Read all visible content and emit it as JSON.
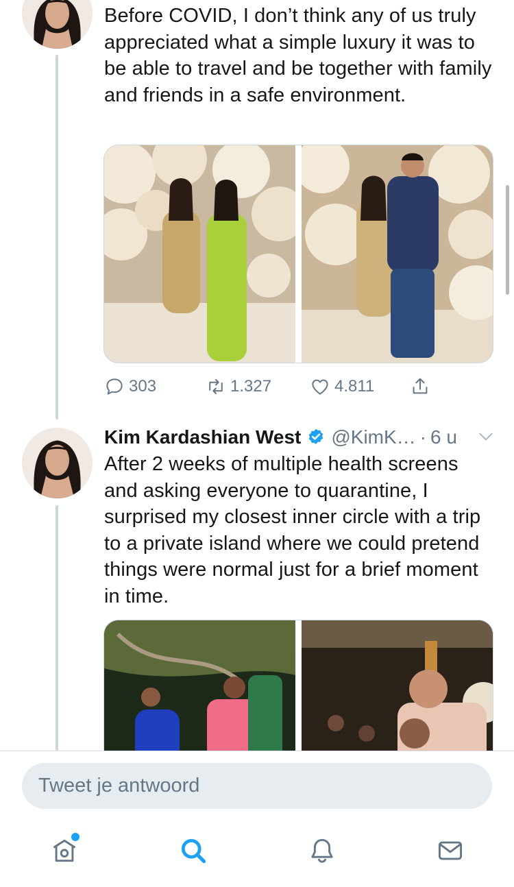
{
  "colors": {
    "accent": "#1da1f2",
    "text": "#14171a",
    "secondary_text": "#657786",
    "thread_line": "#cdd6dd",
    "input_bg": "#e6ecf0"
  },
  "tweets": [
    {
      "text": "Before COVID, I don’t think any of us truly appreciated what a simple luxury it was to be able to travel and be together with family and friends in a safe environment.",
      "avatar_icon": "profile-photo",
      "media_count": 2,
      "actions": {
        "replies": "303",
        "retweets": "1.327",
        "likes": "4.811",
        "reply_icon": "comment-icon",
        "retweet_icon": "retweet-icon",
        "like_icon": "heart-icon",
        "share_icon": "share-icon"
      }
    },
    {
      "author_name": "Kim Kardashian West",
      "handle": "@KimK…",
      "separator": "·",
      "time": "6 u",
      "verified_icon": "verified-badge-icon",
      "menu_icon": "chevron-down-icon",
      "text": "After 2 weeks of multiple health screens and asking everyone to quarantine, I surprised my closest inner circle with a trip to a private island where we could pretend things were normal just for a brief moment in time.",
      "avatar_icon": "profile-photo",
      "media_count": 2
    }
  ],
  "reply": {
    "placeholder": "Tweet je antwoord"
  },
  "tabs": [
    {
      "name": "home",
      "icon": "home-icon",
      "has_notification_dot": true
    },
    {
      "name": "search",
      "icon": "search-icon",
      "active": true
    },
    {
      "name": "notifications",
      "icon": "bell-icon"
    },
    {
      "name": "messages",
      "icon": "mail-icon"
    }
  ]
}
